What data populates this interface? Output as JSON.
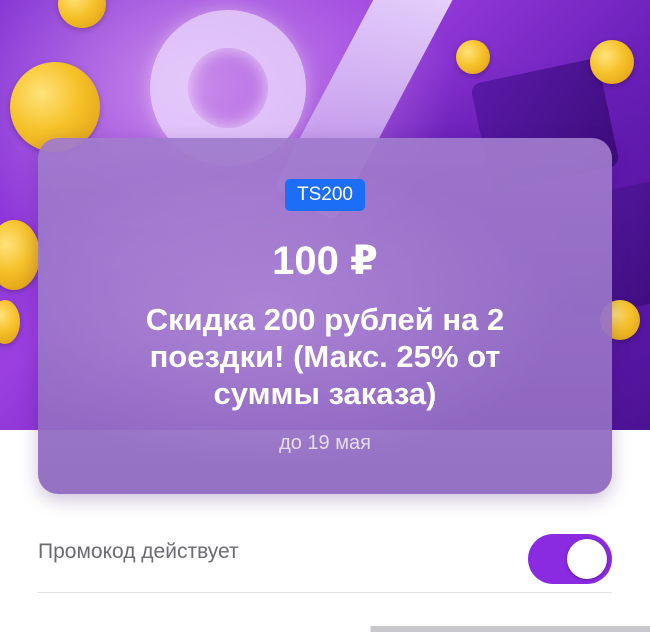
{
  "promo": {
    "code": "TS200",
    "amount": "100 ₽",
    "description": "Скидка 200 рублей на 2 поездки! (Макс. 25% от суммы заказа)",
    "valid_until": "до 19 мая"
  },
  "status": {
    "label": "Промокод действует",
    "toggle_on": true
  },
  "colors": {
    "accent": "#8a2be2",
    "badge": "#1b6ef5"
  },
  "icons": {
    "hero_art": "percent-coins-illustration"
  }
}
